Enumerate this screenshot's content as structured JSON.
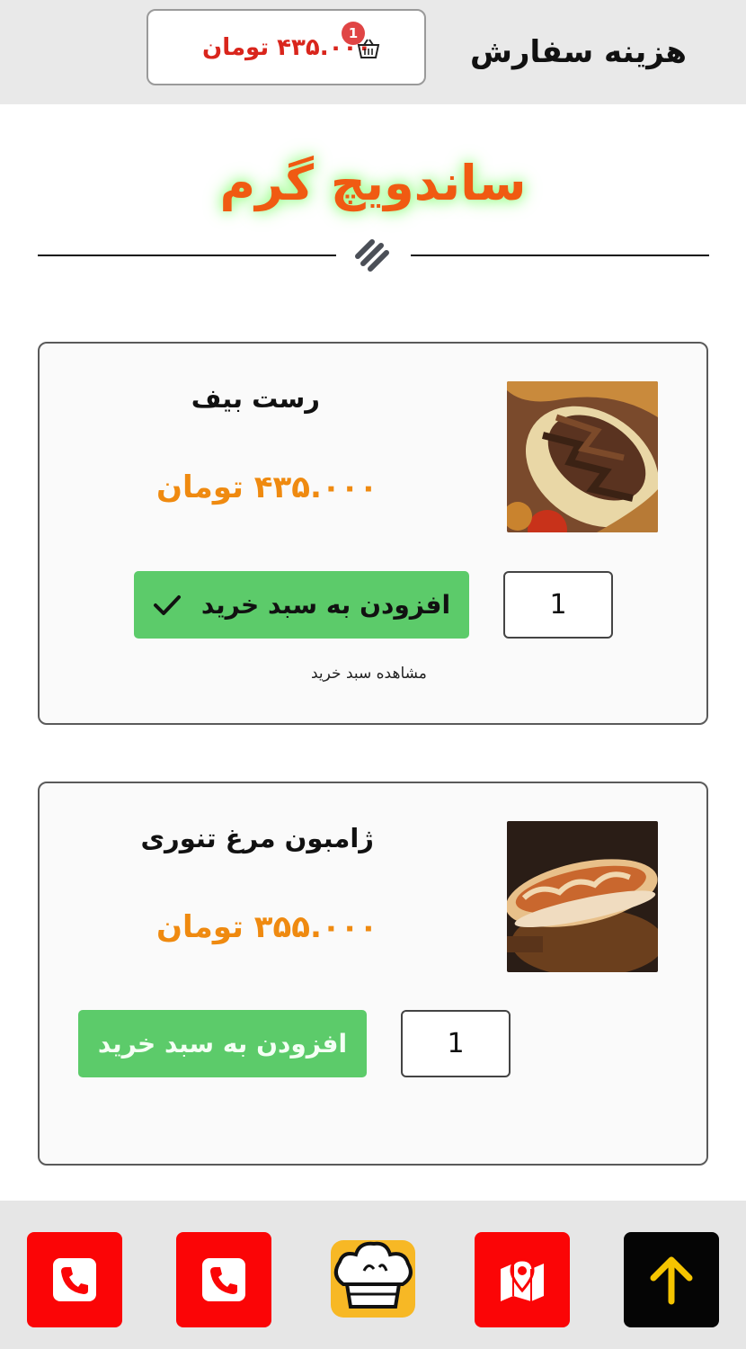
{
  "header": {
    "order_label": "هزینه سفارش",
    "cart_total": "۴۳۵.۰۰۰ تومان",
    "cart_count": "1"
  },
  "section": {
    "title": "ساندویچ گرم"
  },
  "products": [
    {
      "name": "رست بیف",
      "price": "۴۳۵.۰۰۰ تومان",
      "quantity": "1",
      "add_label": "افزودن به سبد خرید",
      "added": true,
      "view_cart_label": "مشاهده سبد خرید"
    },
    {
      "name": "ژامبون مرغ تنوری",
      "price": "۳۵۵.۰۰۰ تومان",
      "quantity": "1",
      "add_label": "افزودن به سبد خرید",
      "added": false
    }
  ],
  "bottom_nav": [
    {
      "icon": "phone-icon",
      "color": "#fb0506"
    },
    {
      "icon": "phone-icon",
      "color": "#fb0506"
    },
    {
      "icon": "chef-hat-logo",
      "color": "#f7b825"
    },
    {
      "icon": "map-pin-icon",
      "color": "#fb0506"
    },
    {
      "icon": "arrow-up-icon",
      "color": "#050505"
    }
  ],
  "colors": {
    "accent_orange": "#f05a12",
    "price_orange": "#ef8a10",
    "cart_red": "#d9251c",
    "button_green": "#5ccb6a"
  }
}
